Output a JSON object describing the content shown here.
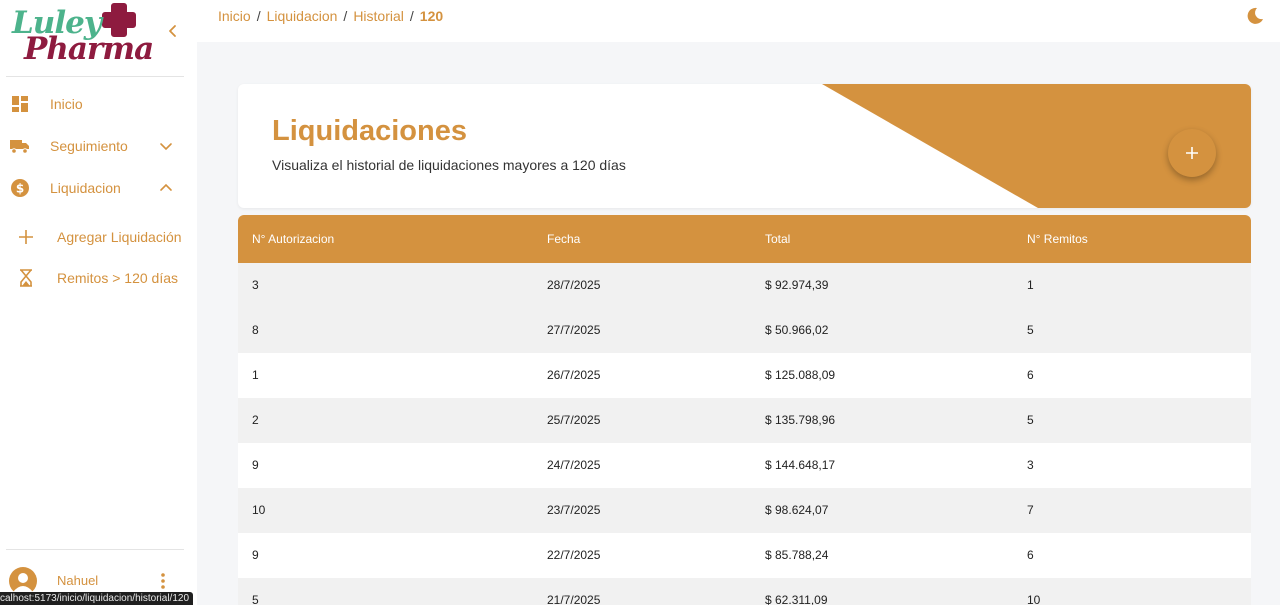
{
  "app": {
    "logo_line1": "Luley",
    "logo_line2": "Pharma"
  },
  "colors": {
    "accent": "#d4923f",
    "brand_green": "#4db38c",
    "brand_maroon": "#8e1b3f"
  },
  "sidebar": {
    "items": [
      {
        "label": "Inicio",
        "icon": "dashboard-icon"
      },
      {
        "label": "Seguimiento",
        "icon": "truck-icon",
        "chevron": "chevron-down-icon"
      },
      {
        "label": "Liquidacion",
        "icon": "dollar-circle-icon",
        "chevron": "chevron-up-icon"
      }
    ],
    "sub_items": [
      {
        "label": "Agregar Liquidación",
        "icon": "plus-icon"
      },
      {
        "label": "Remitos > 120 días",
        "icon": "hourglass-icon"
      }
    ],
    "user": {
      "name": "Nahuel"
    }
  },
  "breadcrumb": {
    "items": [
      "Inicio",
      "Liquidacion",
      "Historial"
    ],
    "current": "120",
    "separator": "/"
  },
  "header": {
    "title": "Liquidaciones",
    "subtitle": "Visualiza el historial de liquidaciones mayores a 120 días"
  },
  "table": {
    "columns": [
      "N° Autorizacion",
      "Fecha",
      "Total",
      "N° Remitos"
    ],
    "rows": [
      [
        "3",
        "28/7/2025",
        "$ 92.974,39",
        "1"
      ],
      [
        "8",
        "27/7/2025",
        "$ 50.966,02",
        "5"
      ],
      [
        "1",
        "26/7/2025",
        "$ 125.088,09",
        "6"
      ],
      [
        "2",
        "25/7/2025",
        "$ 135.798,96",
        "5"
      ],
      [
        "9",
        "24/7/2025",
        "$ 144.648,17",
        "3"
      ],
      [
        "10",
        "23/7/2025",
        "$ 98.624,07",
        "7"
      ],
      [
        "9",
        "22/7/2025",
        "$ 85.788,24",
        "6"
      ],
      [
        "5",
        "21/7/2025",
        "$ 62.311,09",
        "10"
      ]
    ]
  },
  "status_bar": {
    "url": "calhost:5173/inicio/liquidacion/historial/120"
  }
}
